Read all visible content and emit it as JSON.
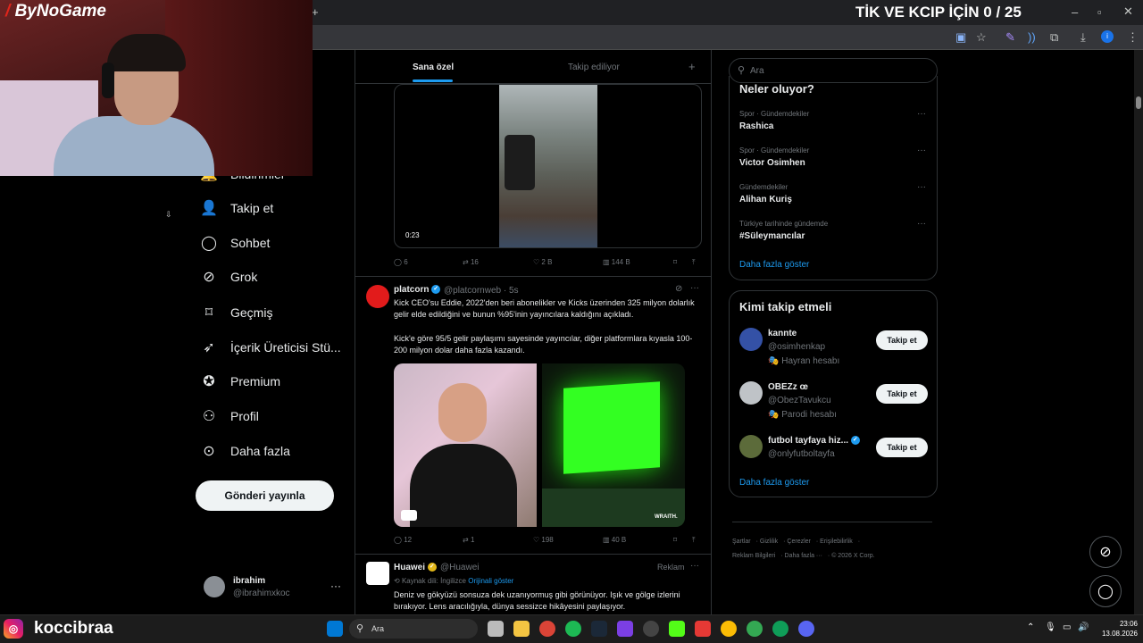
{
  "stream": {
    "logo_text": "ByNoGame",
    "title": "TİK VE KCIP İÇİN 0 / 25",
    "instagram_handle": "koccibraa"
  },
  "nav": {
    "items": [
      {
        "label": "Bildirimler",
        "icon": "bell-icon"
      },
      {
        "label": "Takip et",
        "icon": "add-user-icon"
      },
      {
        "label": "Sohbet",
        "icon": "chat-bubble-icon"
      },
      {
        "label": "Grok",
        "icon": "grok-icon"
      },
      {
        "label": "Geçmiş",
        "icon": "bookmark-icon"
      },
      {
        "label": "İçerik Üreticisi Stü...",
        "icon": "rocket-icon"
      },
      {
        "label": "Premium",
        "icon": "verified-badge-icon"
      },
      {
        "label": "Profil",
        "icon": "person-icon"
      },
      {
        "label": "Daha fazla",
        "icon": "more-circle-icon"
      }
    ],
    "post_button": "Gönderi yayınla",
    "account": {
      "name": "ibrahim",
      "handle": "@ibrahimxkoc",
      "more": "···"
    }
  },
  "feed": {
    "tabs": {
      "for_you": "Sana özel",
      "following": "Takip ediliyor",
      "add": "+"
    },
    "video_post": {
      "video_time": "0:23",
      "replies": "6",
      "reposts": "16",
      "likes": "2 B",
      "views": "144 B"
    },
    "platcorn_post": {
      "name": "platcorn",
      "handle": "@platcornweb · 5s",
      "text1": "Kick CEO'su Eddie, 2022'den beri abonelikler ve Kicks üzerinden 325 milyon dolarlık gelir elde edildiğini ve bunun %95'inin yayıncılara kaldığını açıkladı.",
      "text2": "Kick'e göre 95/5 gelir paylaşımı sayesinde yayıncılar, diğer platformlara kıyasla 100-200 milyon dolar daha fazla kazandı.",
      "img2_watermark": "WRAITH.",
      "replies": "12",
      "reposts": "1",
      "likes": "198",
      "views": "40 B"
    },
    "huawei_post": {
      "name": "Huawei",
      "handle": "@Huawei",
      "ad_label": "Reklam",
      "source_lang": "Kaynak dili: İngilizce",
      "show_original": "Orijinali göster",
      "text": "Deniz ve gökyüzü sonsuza dek uzanıyormuş gibi görünüyor. Işık ve gölge izlerini bırakıyor. Lens aracılığıyla, dünya sessizce hikâyesini paylaşıyor."
    }
  },
  "sidebar": {
    "search_placeholder": "Ara",
    "trends_title": "Neler oluyor?",
    "trends": [
      {
        "meta": "Spor · Gündemdekiler",
        "title": "Rashica"
      },
      {
        "meta": "Spor · Gündemdekiler",
        "title": "Victor Osimhen"
      },
      {
        "meta": "Gündemdekiler",
        "title": "Alihan Kuriş"
      },
      {
        "meta": "Türkiye tarihinde gündemde",
        "title": "#Süleymancılar"
      }
    ],
    "trends_more": "Daha fazla göster",
    "who_title": "Kimi takip etmeli",
    "who": [
      {
        "name": "kannte",
        "handle": "@osimhenkap",
        "badge": "Hayran hesabı",
        "button": "Takip et"
      },
      {
        "name": "OBEZz œ",
        "handle": "@ObezTavukcu",
        "badge": "Parodi hesabı",
        "button": "Takip et"
      },
      {
        "name": "futbol tayfaya hiz...",
        "handle": "@onlyfutboltayfa",
        "badge": "",
        "button": "Takip et"
      }
    ],
    "who_more": "Daha fazla göster",
    "footer": {
      "line1": [
        "Şartlar",
        "Gizlilik",
        "Çerezler",
        "Erişilebilirlik"
      ],
      "line2": [
        "Reklam Bilgileri",
        "Daha fazla ···",
        "© 2026 X Corp."
      ]
    }
  },
  "taskbar": {
    "search_placeholder": "Ara",
    "time": "23:06",
    "date": "13.08.2026"
  },
  "colors": {
    "accent": "#1d9bf0",
    "background": "#000000",
    "text": "#e7e9ea",
    "muted": "#71767b",
    "border": "#2f3336"
  }
}
